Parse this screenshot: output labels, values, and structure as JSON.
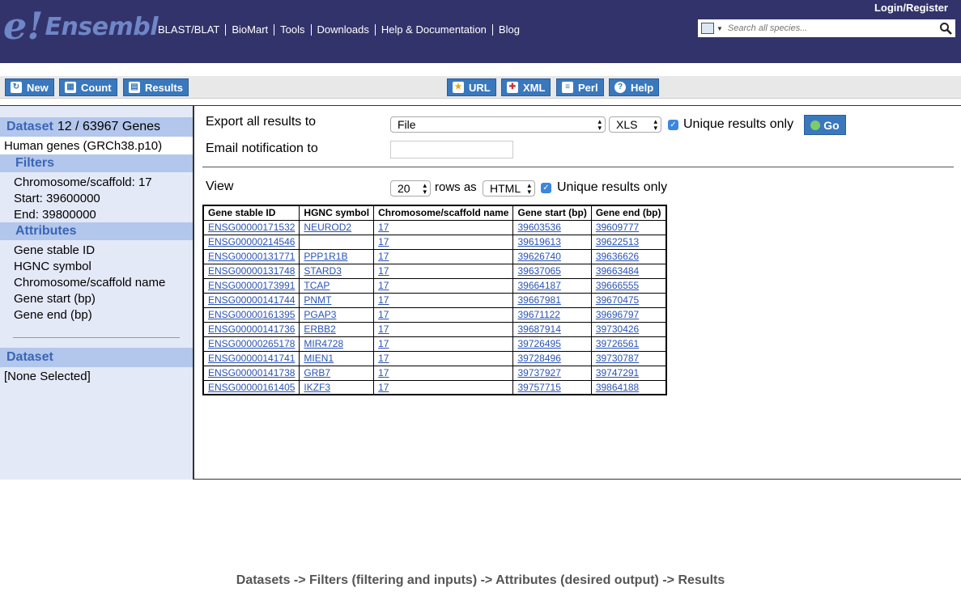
{
  "header": {
    "logo_mark": "e!",
    "logo_text": "Ensembl",
    "nav": [
      "BLAST/BLAT",
      "BioMart",
      "Tools",
      "Downloads",
      "Help & Documentation",
      "Blog"
    ],
    "login": "Login/Register",
    "search_placeholder": "Search all species..."
  },
  "toolbar": {
    "new": "New",
    "count": "Count",
    "results": "Results",
    "url": "URL",
    "xml": "XML",
    "perl": "Perl",
    "help": "Help"
  },
  "sidebar": {
    "dataset_label": "Dataset",
    "dataset_count": "12 / 63967 Genes",
    "dataset_name": "Human genes (GRCh38.p10)",
    "filters_label": "Filters",
    "filters": [
      "Chromosome/scaffold: 17",
      "Start: 39600000",
      "End: 39800000"
    ],
    "attributes_label": "Attributes",
    "attributes": [
      "Gene stable ID",
      "HGNC symbol",
      "Chromosome/scaffold name",
      "Gene start (bp)",
      "Gene end (bp)"
    ],
    "dataset2_label": "Dataset",
    "dataset2_value": "[None Selected]"
  },
  "export": {
    "label": "Export  all results to",
    "destination": "File",
    "format": "XLS",
    "unique_label": "Unique results only",
    "go": "Go",
    "email_label": "Email notification to"
  },
  "view": {
    "label": "View",
    "rows": "20",
    "rows_as": "rows as",
    "format": "HTML",
    "unique_label": "Unique results only"
  },
  "table": {
    "columns": [
      "Gene stable ID",
      "HGNC symbol",
      "Chromosome/scaffold name",
      "Gene start (bp)",
      "Gene end (bp)"
    ],
    "rows": [
      [
        "ENSG00000171532",
        "NEUROD2",
        "17",
        "39603536",
        "39609777"
      ],
      [
        "ENSG00000214546",
        "",
        "17",
        "39619613",
        "39622513"
      ],
      [
        "ENSG00000131771",
        "PPP1R1B",
        "17",
        "39626740",
        "39636626"
      ],
      [
        "ENSG00000131748",
        "STARD3",
        "17",
        "39637065",
        "39663484"
      ],
      [
        "ENSG00000173991",
        "TCAP",
        "17",
        "39664187",
        "39666555"
      ],
      [
        "ENSG00000141744",
        "PNMT",
        "17",
        "39667981",
        "39670475"
      ],
      [
        "ENSG00000161395",
        "PGAP3",
        "17",
        "39671122",
        "39696797"
      ],
      [
        "ENSG00000141736",
        "ERBB2",
        "17",
        "39687914",
        "39730426"
      ],
      [
        "ENSG00000265178",
        "MIR4728",
        "17",
        "39726495",
        "39726561"
      ],
      [
        "ENSG00000141741",
        "MIEN1",
        "17",
        "39728496",
        "39730787"
      ],
      [
        "ENSG00000141738",
        "GRB7",
        "17",
        "39737927",
        "39747291"
      ],
      [
        "ENSG00000161405",
        "IKZF3",
        "17",
        "39757715",
        "39864188"
      ]
    ]
  },
  "footer": "Datasets -> Filters (filtering and inputs) -> Attributes (desired output) -> Results"
}
